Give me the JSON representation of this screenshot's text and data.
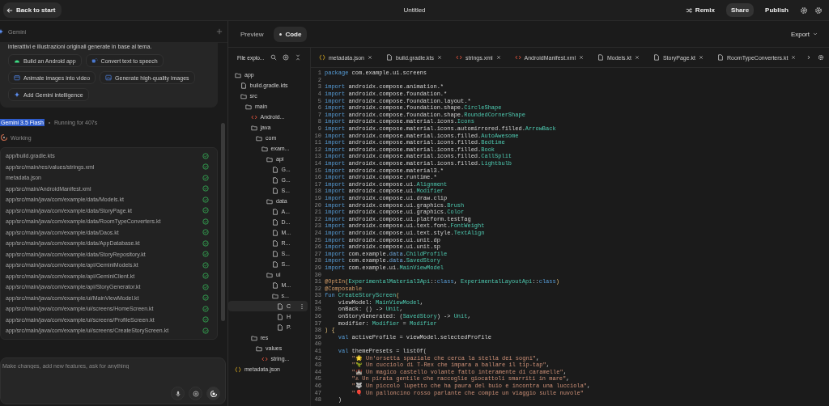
{
  "top_bar": {
    "back_button": "Back to start",
    "title": "Untitled",
    "actions": [
      {
        "label": "Remix",
        "kind": "remix"
      },
      {
        "label": "Share",
        "kind": "share"
      },
      {
        "label": "Publish",
        "kind": "publish"
      }
    ]
  },
  "assistant": {
    "header": "Gemini",
    "message_tail": "interattivi e illustrazioni originali generate in base al tema.",
    "suggestions": [
      {
        "label": "Build an Android app",
        "kind": "android"
      },
      {
        "label": "Convert text to speech",
        "kind": "speech"
      },
      {
        "label": "Animate images into video",
        "kind": "video"
      },
      {
        "label": "Generate high-quality images",
        "kind": "image"
      },
      {
        "label": "Add Gemini intelligence",
        "kind": "sparkle"
      }
    ],
    "model": {
      "name": "Gemini 3.5 Flash",
      "text_selected": true,
      "status": "Running for 407s"
    },
    "working": "Working",
    "files": [
      {
        "path": "app/build.gradle.kts",
        "done": true
      },
      {
        "path": "app/src/main/res/values/strings.xml",
        "done": true
      },
      {
        "path": "metadata.json",
        "done": true
      },
      {
        "path": "app/src/main/AndroidManifest.xml",
        "done": true
      },
      {
        "path": "app/src/main/java/com/example/data/Models.kt",
        "done": true
      },
      {
        "path": "app/src/main/java/com/example/data/StoryPage.kt",
        "done": true
      },
      {
        "path": "app/src/main/java/com/example/data/RoomTypeConverters.kt",
        "done": true
      },
      {
        "path": "app/src/main/java/com/example/data/Daos.kt",
        "done": true
      },
      {
        "path": "app/src/main/java/com/example/data/AppDatabase.kt",
        "done": true
      },
      {
        "path": "app/src/main/java/com/example/data/StoryRepository.kt",
        "done": true
      },
      {
        "path": "app/src/main/java/com/example/api/GeminiModels.kt",
        "done": true
      },
      {
        "path": "app/src/main/java/com/example/api/GeminiClient.kt",
        "done": true
      },
      {
        "path": "app/src/main/java/com/example/api/StoryGenerator.kt",
        "done": true
      },
      {
        "path": "app/src/main/java/com/example/ui/MainViewModel.kt",
        "done": true
      },
      {
        "path": "app/src/main/java/com/example/ui/screens/HomeScreen.kt",
        "done": true
      },
      {
        "path": "app/src/main/java/com/example/ui/screens/ProfileScreen.kt",
        "done": true
      },
      {
        "path": "app/src/main/java/com/example/ui/screens/CreateStoryScreen.kt",
        "done": true
      }
    ],
    "input": {
      "placeholder": "Make changes, add new features, ask for anything"
    }
  },
  "view_tabs": [
    {
      "label": "Preview",
      "selected": false
    },
    {
      "label": "Code",
      "selected": true
    }
  ],
  "export_button": "Export",
  "explorer": {
    "title": "File explo...",
    "tree": [
      {
        "label": "app",
        "kind": "folder",
        "selected": false,
        "children": [
          {
            "label": "build.gradle.kts",
            "kind": "file",
            "selected": false
          },
          {
            "label": "src",
            "kind": "folder",
            "selected": false,
            "children": [
              {
                "label": "main",
                "kind": "folder",
                "selected": false,
                "children": [
                  {
                    "label": "Android...",
                    "kind": "xml",
                    "selected": false
                  },
                  {
                    "label": "java",
                    "kind": "folder",
                    "selected": false,
                    "children": [
                      {
                        "label": "com",
                        "kind": "folder",
                        "selected": false,
                        "children": [
                          {
                            "label": "exam...",
                            "kind": "folder",
                            "selected": false,
                            "children": [
                              {
                                "label": "api",
                                "kind": "folder",
                                "selected": false,
                                "children": [
                                  {
                                    "label": "G...",
                                    "kind": "file",
                                    "selected": false
                                  },
                                  {
                                    "label": "G...",
                                    "kind": "file",
                                    "selected": false
                                  },
                                  {
                                    "label": "S...",
                                    "kind": "file",
                                    "selected": false
                                  }
                                ]
                              },
                              {
                                "label": "data",
                                "kind": "folder",
                                "selected": false,
                                "children": [
                                  {
                                    "label": "A...",
                                    "kind": "file",
                                    "selected": false
                                  },
                                  {
                                    "label": "D...",
                                    "kind": "file",
                                    "selected": false
                                  },
                                  {
                                    "label": "M...",
                                    "kind": "file",
                                    "selected": false
                                  },
                                  {
                                    "label": "R...",
                                    "kind": "file",
                                    "selected": false
                                  },
                                  {
                                    "label": "S...",
                                    "kind": "file",
                                    "selected": false
                                  },
                                  {
                                    "label": "S...",
                                    "kind": "file",
                                    "selected": false
                                  }
                                ]
                              },
                              {
                                "label": "ui",
                                "kind": "folder",
                                "selected": false,
                                "children": [
                                  {
                                    "label": "M...",
                                    "kind": "file",
                                    "selected": false
                                  },
                                  {
                                    "label": "s...",
                                    "kind": "folder",
                                    "selected": false,
                                    "children": [
                                      {
                                        "label": "C",
                                        "kind": "file",
                                        "selected": true
                                      },
                                      {
                                        "label": "H",
                                        "kind": "file",
                                        "selected": false
                                      },
                                      {
                                        "label": "P.",
                                        "kind": "file",
                                        "selected": false
                                      }
                                    ]
                                  }
                                ]
                              }
                            ]
                          }
                        ]
                      }
                    ]
                  },
                  {
                    "label": "res",
                    "kind": "folder",
                    "selected": false,
                    "children": [
                      {
                        "label": "values",
                        "kind": "folder",
                        "selected": false,
                        "children": [
                          {
                            "label": "string...",
                            "kind": "xml",
                            "selected": false
                          }
                        ]
                      }
                    ]
                  }
                ]
              }
            ]
          }
        ]
      },
      {
        "label": "metadata.json",
        "kind": "json",
        "selected": false
      }
    ]
  },
  "file_tabs": [
    {
      "label": "metadata.json",
      "kind": "json",
      "selected": false
    },
    {
      "label": "build.gradle.kts",
      "kind": "file",
      "selected": false
    },
    {
      "label": "strings.xml",
      "kind": "xml",
      "selected": false
    },
    {
      "label": "AndroidManifest.xml",
      "kind": "xml",
      "selected": false
    },
    {
      "label": "Models.kt",
      "kind": "file",
      "selected": false
    },
    {
      "label": "StoryPage.kt",
      "kind": "file",
      "selected": false
    },
    {
      "label": "RoomTypeConverters.kt",
      "kind": "file",
      "selected": false
    }
  ],
  "code": [
    {
      "number": "1",
      "tokens": [
        {
          "kind": "keyword",
          "text": "package"
        },
        {
          "kind": "plain",
          "text": " com.example.ui.screens"
        }
      ]
    },
    {
      "number": "2"
    },
    {
      "number": "3",
      "tokens": [
        {
          "kind": "keyword",
          "text": "import"
        },
        {
          "kind": "plain",
          "text": " androidx.compose.animation.*"
        }
      ]
    },
    {
      "number": "4",
      "tokens": [
        {
          "kind": "keyword",
          "text": "import"
        },
        {
          "kind": "plain",
          "text": " androidx.compose.foundation.*"
        }
      ]
    },
    {
      "number": "5",
      "tokens": [
        {
          "kind": "keyword",
          "text": "import"
        },
        {
          "kind": "plain",
          "text": " androidx.compose.foundation.layout.*"
        }
      ]
    },
    {
      "number": "6",
      "tokens": [
        {
          "kind": "keyword",
          "text": "import"
        },
        {
          "kind": "plain",
          "text": " androidx.compose.foundation.shape."
        },
        {
          "kind": "type",
          "text": "CircleShape"
        }
      ]
    },
    {
      "number": "7",
      "tokens": [
        {
          "kind": "keyword",
          "text": "import"
        },
        {
          "kind": "plain",
          "text": " androidx.compose.foundation.shape."
        },
        {
          "kind": "type",
          "text": "RoundedCornerShape"
        }
      ]
    },
    {
      "number": "8",
      "tokens": [
        {
          "kind": "keyword",
          "text": "import"
        },
        {
          "kind": "plain",
          "text": " androidx.compose.material.icons."
        },
        {
          "kind": "type",
          "text": "Icons"
        }
      ]
    },
    {
      "number": "9",
      "tokens": [
        {
          "kind": "keyword",
          "text": "import"
        },
        {
          "kind": "plain",
          "text": " androidx.compose.material.icons.automirrored.filled."
        },
        {
          "kind": "type",
          "text": "ArrowBack"
        }
      ]
    },
    {
      "number": "10",
      "tokens": [
        {
          "kind": "keyword",
          "text": "import"
        },
        {
          "kind": "plain",
          "text": " androidx.compose.material.icons.filled."
        },
        {
          "kind": "type",
          "text": "AutoAwesome"
        }
      ]
    },
    {
      "number": "11",
      "tokens": [
        {
          "kind": "keyword",
          "text": "import"
        },
        {
          "kind": "plain",
          "text": " androidx.compose.material.icons.filled."
        },
        {
          "kind": "type",
          "text": "Bedtime"
        }
      ]
    },
    {
      "number": "12",
      "tokens": [
        {
          "kind": "keyword",
          "text": "import"
        },
        {
          "kind": "plain",
          "text": " androidx.compose.material.icons.filled."
        },
        {
          "kind": "type",
          "text": "Book"
        }
      ]
    },
    {
      "number": "13",
      "tokens": [
        {
          "kind": "keyword",
          "text": "import"
        },
        {
          "kind": "plain",
          "text": " androidx.compose.material.icons.filled."
        },
        {
          "kind": "type",
          "text": "CallSplit"
        }
      ]
    },
    {
      "number": "14",
      "tokens": [
        {
          "kind": "keyword",
          "text": "import"
        },
        {
          "kind": "plain",
          "text": " androidx.compose.material.icons.filled."
        },
        {
          "kind": "type",
          "text": "Lightbulb"
        }
      ]
    },
    {
      "number": "15",
      "tokens": [
        {
          "kind": "keyword",
          "text": "import"
        },
        {
          "kind": "plain",
          "text": " androidx.compose.material3.*"
        }
      ]
    },
    {
      "number": "16",
      "tokens": [
        {
          "kind": "keyword",
          "text": "import"
        },
        {
          "kind": "plain",
          "text": " androidx.compose.runtime.*"
        }
      ]
    },
    {
      "number": "17",
      "tokens": [
        {
          "kind": "keyword",
          "text": "import"
        },
        {
          "kind": "plain",
          "text": " androidx.compose.ui."
        },
        {
          "kind": "type",
          "text": "Alignment"
        }
      ]
    },
    {
      "number": "18",
      "tokens": [
        {
          "kind": "keyword",
          "text": "import"
        },
        {
          "kind": "plain",
          "text": " androidx.compose.ui."
        },
        {
          "kind": "type",
          "text": "Modifier"
        }
      ]
    },
    {
      "number": "19",
      "tokens": [
        {
          "kind": "keyword",
          "text": "import"
        },
        {
          "kind": "plain",
          "text": " androidx.compose.ui.draw.clip"
        }
      ]
    },
    {
      "number": "20",
      "tokens": [
        {
          "kind": "keyword",
          "text": "import"
        },
        {
          "kind": "plain",
          "text": " androidx.compose.ui.graphics."
        },
        {
          "kind": "type",
          "text": "Brush"
        }
      ]
    },
    {
      "number": "21",
      "tokens": [
        {
          "kind": "keyword",
          "text": "import"
        },
        {
          "kind": "plain",
          "text": " androidx.compose.ui.graphics."
        },
        {
          "kind": "type",
          "text": "Color"
        }
      ]
    },
    {
      "number": "22",
      "tokens": [
        {
          "kind": "keyword",
          "text": "import"
        },
        {
          "kind": "plain",
          "text": " androidx.compose.ui.platform.testTag"
        }
      ]
    },
    {
      "number": "23",
      "tokens": [
        {
          "kind": "keyword",
          "text": "import"
        },
        {
          "kind": "plain",
          "text": " androidx.compose.ui.text.font."
        },
        {
          "kind": "type",
          "text": "FontWeight"
        }
      ]
    },
    {
      "number": "24",
      "tokens": [
        {
          "kind": "keyword",
          "text": "import"
        },
        {
          "kind": "plain",
          "text": " androidx.compose.ui.text.style."
        },
        {
          "kind": "type",
          "text": "TextAlign"
        }
      ]
    },
    {
      "number": "25",
      "tokens": [
        {
          "kind": "keyword",
          "text": "import"
        },
        {
          "kind": "plain",
          "text": " androidx.compose.ui.unit.dp"
        }
      ]
    },
    {
      "number": "26",
      "tokens": [
        {
          "kind": "keyword",
          "text": "import"
        },
        {
          "kind": "plain",
          "text": " androidx.compose.ui.unit.sp"
        }
      ]
    },
    {
      "number": "27",
      "tokens": [
        {
          "kind": "keyword",
          "text": "import"
        },
        {
          "kind": "plain",
          "text": " com.example."
        },
        {
          "kind": "package",
          "text": "data"
        },
        {
          "kind": "plain",
          "text": "."
        },
        {
          "kind": "type",
          "text": "ChildProfile"
        }
      ]
    },
    {
      "number": "28",
      "tokens": [
        {
          "kind": "keyword",
          "text": "import"
        },
        {
          "kind": "plain",
          "text": " com.example."
        },
        {
          "kind": "package",
          "text": "data"
        },
        {
          "kind": "plain",
          "text": "."
        },
        {
          "kind": "type",
          "text": "SavedStory"
        }
      ]
    },
    {
      "number": "29",
      "tokens": [
        {
          "kind": "keyword",
          "text": "import"
        },
        {
          "kind": "plain",
          "text": " com.example.ui."
        },
        {
          "kind": "type",
          "text": "MainViewModel"
        }
      ]
    },
    {
      "number": "30"
    },
    {
      "number": "31",
      "tokens": [
        {
          "kind": "annotation",
          "text": "@OptIn"
        },
        {
          "kind": "bracket",
          "text": "("
        },
        {
          "kind": "type",
          "text": "ExperimentalMaterial3Api"
        },
        {
          "kind": "plain",
          "text": "::"
        },
        {
          "kind": "keyword",
          "text": "class"
        },
        {
          "kind": "plain",
          "text": ", "
        },
        {
          "kind": "type",
          "text": "ExperimentalLayoutApi"
        },
        {
          "kind": "plain",
          "text": "::"
        },
        {
          "kind": "keyword",
          "text": "class"
        },
        {
          "kind": "bracket",
          "text": ")"
        }
      ]
    },
    {
      "number": "32",
      "tokens": [
        {
          "kind": "annotation",
          "text": "@Composable"
        }
      ]
    },
    {
      "number": "33",
      "tokens": [
        {
          "kind": "keyword",
          "text": "fun"
        },
        {
          "kind": "type",
          "text": " CreateStoryScreen"
        },
        {
          "kind": "bracket",
          "text": "("
        }
      ]
    },
    {
      "number": "34",
      "tokens": [
        {
          "kind": "plain",
          "text": "    viewModel: "
        },
        {
          "kind": "type",
          "text": "MainViewModel"
        },
        {
          "kind": "plain",
          "text": ","
        }
      ]
    },
    {
      "number": "35",
      "tokens": [
        {
          "kind": "plain",
          "text": "    onBack: () -> "
        },
        {
          "kind": "type",
          "text": "Unit"
        },
        {
          "kind": "plain",
          "text": ","
        }
      ]
    },
    {
      "number": "36",
      "tokens": [
        {
          "kind": "plain",
          "text": "    onStoryGenerated: ("
        },
        {
          "kind": "type",
          "text": "SavedStory"
        },
        {
          "kind": "plain",
          "text": ") -> "
        },
        {
          "kind": "type",
          "text": "Unit"
        },
        {
          "kind": "plain",
          "text": ","
        }
      ]
    },
    {
      "number": "37",
      "tokens": [
        {
          "kind": "plain",
          "text": "    modifier: "
        },
        {
          "kind": "type",
          "text": "Modifier"
        },
        {
          "kind": "plain",
          "text": " = "
        },
        {
          "kind": "type",
          "text": "Modifier"
        }
      ]
    },
    {
      "number": "38",
      "tokens": [
        {
          "kind": "bracket",
          "text": ") {"
        }
      ]
    },
    {
      "number": "39",
      "tokens": [
        {
          "kind": "keyword",
          "text": "    val"
        },
        {
          "kind": "plain",
          "text": " activeProfile = viewModel.selectedProfile"
        }
      ]
    },
    {
      "number": "40"
    },
    {
      "number": "41",
      "tokens": [
        {
          "kind": "keyword",
          "text": "    val"
        },
        {
          "kind": "plain",
          "text": " themePresets = listOf("
        }
      ]
    },
    {
      "number": "42",
      "tokens": [
        {
          "kind": "string",
          "text": "        \"🌟 Un'orsetta spaziale che cerca la stella dei sogni\""
        },
        {
          "kind": "plain",
          "text": ","
        }
      ]
    },
    {
      "number": "43",
      "tokens": [
        {
          "kind": "string",
          "text": "        \"🦖 Un cucciolo di T-Rex che impara a ballare il tip-tap\""
        },
        {
          "kind": "plain",
          "text": ","
        }
      ]
    },
    {
      "number": "44",
      "tokens": [
        {
          "kind": "string",
          "text": "        \"🏰 Un magico castello volante fatto interamente di caramelle\""
        },
        {
          "kind": "plain",
          "text": ","
        }
      ]
    },
    {
      "number": "45",
      "tokens": [
        {
          "kind": "string",
          "text": "        \"⚓ Un pirata gentile che raccoglie giocattoli smarriti in mare\""
        },
        {
          "kind": "plain",
          "text": ","
        }
      ]
    },
    {
      "number": "46",
      "tokens": [
        {
          "kind": "string",
          "text": "        \"🐺 Un piccolo lupetto che ha paura del buio e incontra una lucciola\""
        },
        {
          "kind": "plain",
          "text": ","
        }
      ]
    },
    {
      "number": "47",
      "tokens": [
        {
          "kind": "string",
          "text": "        \"🎈 Un palloncino rosso parlante che compie un viaggio sulle nuvole\""
        }
      ]
    },
    {
      "number": "48",
      "tokens": [
        {
          "kind": "plain",
          "text": "    )"
        }
      ]
    }
  ]
}
